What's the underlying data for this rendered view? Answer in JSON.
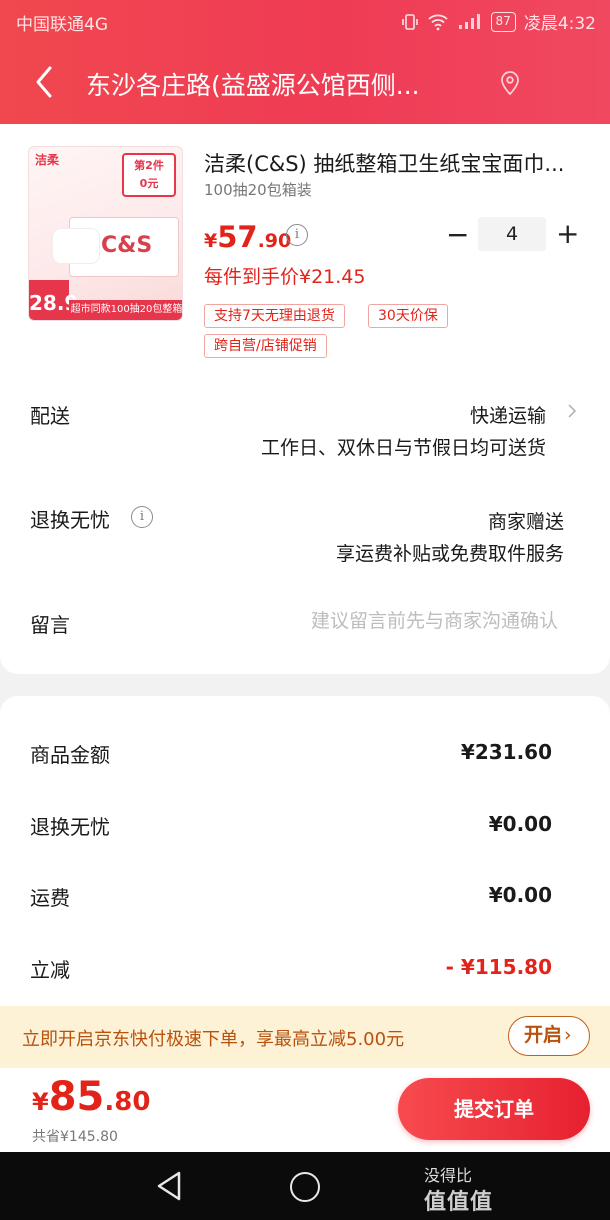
{
  "status_bar": {
    "carrier": "中国联通4G",
    "battery": "87",
    "time": "凌晨4:32"
  },
  "nav": {
    "address": "东沙各庄路(益盛源公馆西侧..."
  },
  "product": {
    "image": {
      "brand": "洁柔",
      "badge_line1": "第2件",
      "badge_line2": "0元",
      "logo": "C&S",
      "price_tag": "28.9",
      "strip": "超市同款100抽20包整箱"
    },
    "title": "洁柔(C&S) 抽纸整箱卫生纸宝宝面巾...",
    "spec": "100抽20包箱装",
    "price_symbol": "¥",
    "price_int": "57",
    "price_dec": ".90",
    "quantity": "4",
    "unit_price": "每件到手价¥21.45",
    "tags": [
      "支持7天无理由退货",
      "30天价保",
      "跨自营/店铺促销"
    ]
  },
  "delivery": {
    "label": "配送",
    "method": "快递运输",
    "schedule": "工作日、双休日与节假日均可送货"
  },
  "return_service": {
    "label": "退换无忧",
    "value": "商家赠送",
    "detail": "享运费补贴或免费取件服务"
  },
  "note": {
    "label": "留言",
    "placeholder": "建议留言前先与商家沟通确认"
  },
  "summary": [
    {
      "label": "商品金额",
      "value": "¥231.60"
    },
    {
      "label": "退换无忧",
      "value": "¥0.00"
    },
    {
      "label": "运费",
      "value": "¥0.00"
    },
    {
      "label": "立减",
      "value": "- ¥115.80"
    }
  ],
  "promo": {
    "text": "立即开启京东快付极速下单，享最高立减5.00元",
    "button": "开启"
  },
  "checkout": {
    "symbol": "¥",
    "total_int": "85",
    "total_dec": ".80",
    "saved": "共省¥145.80",
    "submit": "提交订单"
  },
  "watermark": {
    "line1": "没得比",
    "line2": "值值值"
  },
  "colors": {
    "header_red": "#ef3c55",
    "price_red": "#e2231a",
    "banner_bg": "#fdf1d6",
    "banner_text": "#b8520d"
  }
}
